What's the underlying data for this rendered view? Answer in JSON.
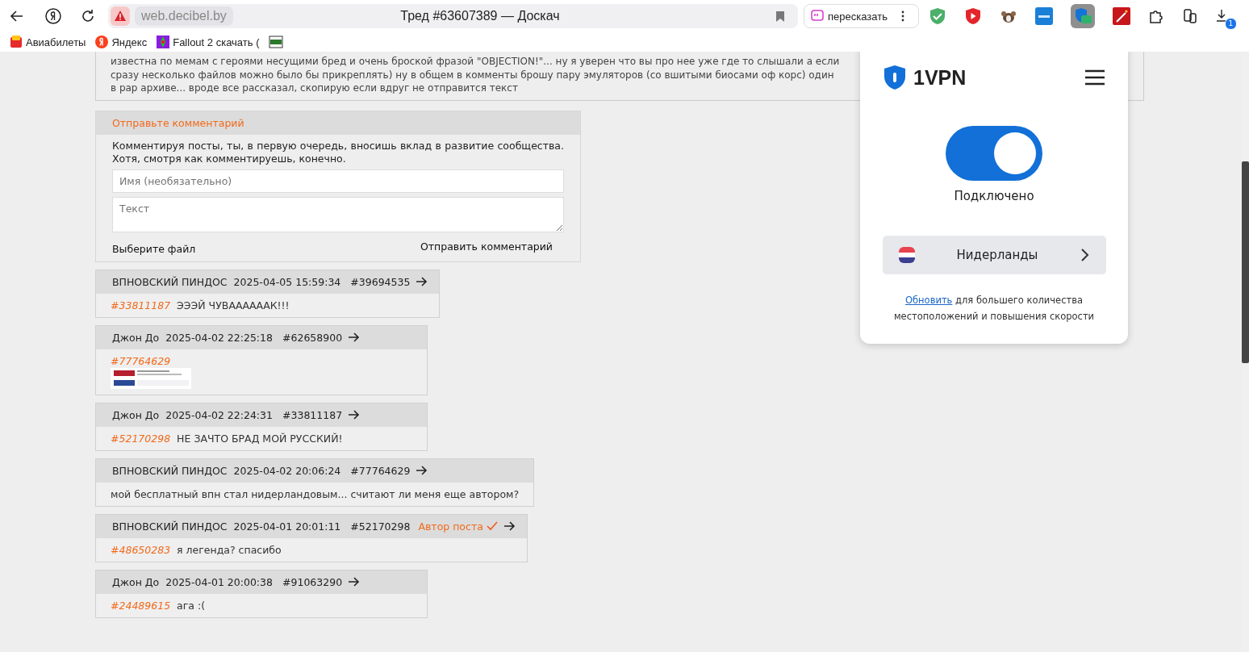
{
  "browser": {
    "address": "web.decibel.by",
    "title": "Тред #63607389 — Доскач",
    "retell": "пересказать",
    "downloads_badge": "1",
    "bookmarks": [
      {
        "label": "Авиабилеты",
        "kind": "tickets"
      },
      {
        "label": "Яндекс",
        "kind": "yandex"
      },
      {
        "label": "Fallout 2 скачать (",
        "kind": "game"
      },
      {
        "kind": "gif"
      }
    ]
  },
  "op_excerpt": [
    "известна по мемам с героями несущими бред и очень броской фразой \"OBJECTION!\"... ну я уверен что вы про нее уже где то слышали а если",
    "сразу несколько файлов можно было бы прикреплять) ну в общем в комменты брошу пару эмуляторов (со вшитыми биосами оф корс) один",
    "в рар архиве... вроде все рассказал, скопирую если вдруг не отправится текст"
  ],
  "comment_form": {
    "title": "Отправьте комментарий",
    "intro": "Комментируя посты, ты, в первую очередь, вносишь вклад в развитие сообщества. Хотя, смотря как комментируешь, конечно.",
    "name_placeholder": "Имя (необязательно)",
    "text_placeholder": "Текст",
    "file_button": "Выберите файл",
    "submit": "Отправить комментарий"
  },
  "comments": [
    {
      "author": "ВПНОВСКИЙ ПИНДОС",
      "date": "2025-04-05 15:59:34",
      "number": "#39694535",
      "reply_to": "#33811187",
      "text": "ЭЭЭЙ ЧУВААААААК!!!"
    },
    {
      "author": "Джон До",
      "date": "2025-04-02 22:25:18",
      "number": "#62658900",
      "reply_to": "#77764629"
    },
    {
      "author": "Джон До",
      "date": "2025-04-02 22:24:31",
      "number": "#33811187",
      "reply_to": "#52170298",
      "text": "НЕ ЗАЧТО БРАД МОЙ РУССКИЙ!"
    },
    {
      "author": "ВПНОВСКИЙ ПИНДОС",
      "date": "2025-04-02 20:06:24",
      "number": "#77764629",
      "text": "мой бесплатный впн стал нидерландовым... считают ли меня еще автором?"
    },
    {
      "author": "ВПНОВСКИЙ ПИНДОС",
      "date": "2025-04-01 20:01:11",
      "number": "#52170298",
      "badge": "Автор поста",
      "reply_to": "#48650283",
      "text": "я легенда? спасибо"
    },
    {
      "author": "Джон До",
      "date": "2025-04-01 20:00:38",
      "number": "#91063290",
      "reply_to": "#24489615",
      "text": "ага :("
    }
  ],
  "vpn_popup": {
    "brand": "1VPN",
    "connected": true,
    "status": "Подключено",
    "country": "Нидерланды",
    "upgrade_link": "Обновить",
    "upgrade_text": "для большего количества местоположений и повышения скорости"
  }
}
